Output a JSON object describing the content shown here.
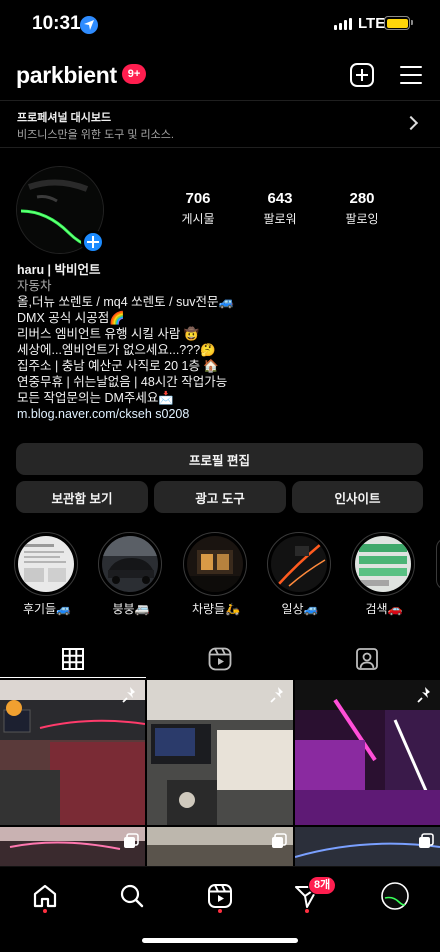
{
  "status_bar": {
    "time": "10:31",
    "network": "LTE",
    "battery_color": "#ffd60a"
  },
  "header": {
    "username": "parkbient",
    "notification_badge": "9+",
    "add_icon": "plus-square-icon",
    "menu_icon": "hamburger-menu-icon"
  },
  "dashboard": {
    "title": "프로페셔널 대시보드",
    "subtitle": "비즈니스만을 위한 도구 및 리소스."
  },
  "profile": {
    "stats": [
      {
        "value": "706",
        "label": "게시물"
      },
      {
        "value": "643",
        "label": "팔로워"
      },
      {
        "value": "280",
        "label": "팔로잉"
      }
    ],
    "name": "haru | 박비언트",
    "category": "자동차",
    "bio_lines": [
      "올,더뉴 쏘렌토 / mq4 쏘렌토 / suv전문🚙",
      "DMX 공식 시공점🌈",
      "리버스 엠비언트 유행 시킬 사람 🤠",
      "세상에...엠비언트가 없으세요...???🤔",
      "집주소 | 충남 예산군 사직로 20 1층 🏠",
      "연중무휴 | 쉬는날없음 | 48시간 작업가능",
      "모든 작업문의는 DM주세요📩"
    ],
    "link": "m.blog.naver.com/ckseh s0208"
  },
  "buttons": {
    "edit_profile": "프로필 편집",
    "archive": "보관함 보기",
    "ad_tools": "광고 도구",
    "insights": "인사이트"
  },
  "highlights": [
    {
      "label": "후기들🚙"
    },
    {
      "label": "붕붕🚐"
    },
    {
      "label": "차량들🛵"
    },
    {
      "label": "일상🚙"
    },
    {
      "label": "검색🚗"
    }
  ],
  "tabs": [
    {
      "name": "grid",
      "icon": "grid-icon"
    },
    {
      "name": "reels",
      "icon": "reels-icon"
    },
    {
      "name": "tagged",
      "icon": "tagged-person-icon"
    }
  ],
  "bottom_nav": {
    "items": [
      "home-icon",
      "search-icon",
      "reels-icon",
      "direct-message-icon",
      "profile-avatar"
    ],
    "dm_badge": "8개",
    "accent": "#ff3040"
  }
}
